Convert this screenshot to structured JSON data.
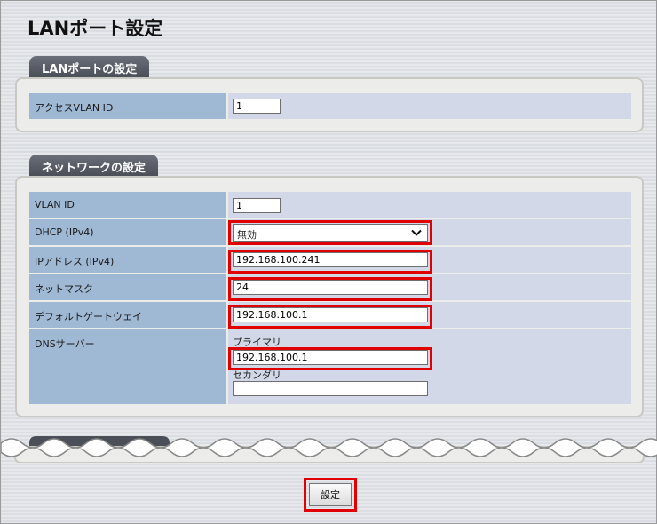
{
  "page": {
    "title": "LANポート設定"
  },
  "lan_port_section": {
    "tab_label": "LANポートの設定",
    "rows": [
      {
        "label": "アクセスVLAN ID",
        "value": "1"
      }
    ]
  },
  "network_section": {
    "tab_label": "ネットワークの設定",
    "vlan_id": {
      "label": "VLAN ID",
      "value": "1"
    },
    "dhcp": {
      "label": "DHCP (IPv4)",
      "selected": "無効"
    },
    "ip_address": {
      "label": "IPアドレス (IPv4)",
      "value": "192.168.100.241"
    },
    "netmask": {
      "label": "ネットマスク",
      "value": "24"
    },
    "gateway": {
      "label": "デフォルトゲートウェイ",
      "value": "192.168.100.1"
    },
    "dns": {
      "label": "DNSサーバー",
      "primary_label": "プライマリ",
      "primary_value": "192.168.100.1",
      "secondary_label": "セカンダリ",
      "secondary_value": ""
    }
  },
  "actions": {
    "submit_label": "設定"
  },
  "colors": {
    "highlight": "#e00000",
    "label_bg": "#9fb8d4",
    "value_bg": "#d2d8e8",
    "tab_bg": "#4b4f58"
  },
  "icons": {
    "select_arrow": "chevron-down-icon"
  }
}
